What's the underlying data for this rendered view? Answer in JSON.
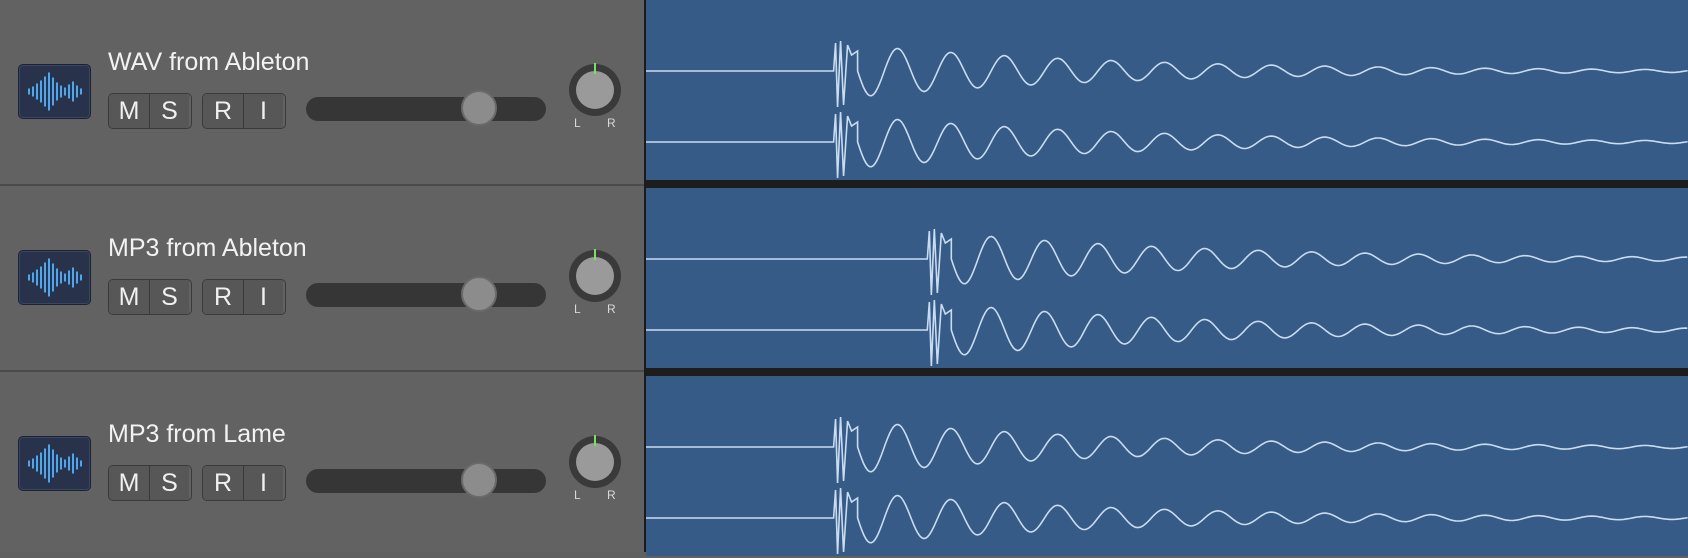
{
  "colors": {
    "track_header_bg": "#626262",
    "region_bg": "#355b86",
    "waveform": "#c9dcf2",
    "icon_wave": "#4ea6ec",
    "pan_indicator": "#7ddc6a"
  },
  "tracks": [
    {
      "name": "WAV from Ableton",
      "buttons": {
        "mute": "M",
        "solo": "S",
        "record": "R",
        "input": "I"
      },
      "volume": 0.72,
      "pan_labels": {
        "left": "L",
        "right": "R"
      },
      "icon": "audio-waveform-icon",
      "wave_onset": 0.18
    },
    {
      "name": "MP3 from Ableton",
      "buttons": {
        "mute": "M",
        "solo": "S",
        "record": "R",
        "input": "I"
      },
      "volume": 0.72,
      "pan_labels": {
        "left": "L",
        "right": "R"
      },
      "icon": "audio-waveform-icon",
      "wave_onset": 0.27
    },
    {
      "name": "MP3 from Lame",
      "buttons": {
        "mute": "M",
        "solo": "S",
        "record": "R",
        "input": "I"
      },
      "volume": 0.72,
      "pan_labels": {
        "left": "L",
        "right": "R"
      },
      "icon": "audio-waveform-icon",
      "wave_onset": 0.18
    }
  ]
}
